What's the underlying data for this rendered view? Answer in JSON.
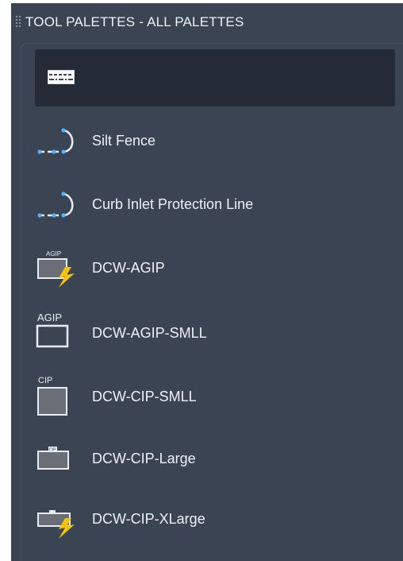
{
  "palette": {
    "title": "TOOL PALETTES - ALL PALETTES",
    "colors": {
      "background": "#3b4453",
      "selected_row": "#252b36",
      "text": "#eef1f5",
      "accent_blue": "#4fb3ff",
      "accent_yellow": "#f5c20f"
    }
  },
  "tools": [
    {
      "label": "Silt Fence",
      "icon": "silt-fence-line-icon"
    },
    {
      "label": "Curb Inlet Protection Line",
      "icon": "curb-inlet-protection-line-icon"
    },
    {
      "label": "DCW-AGIP",
      "icon": "agip-block-icon"
    },
    {
      "label": "DCW-AGIP-SMLL",
      "icon": "agip-small-block-icon"
    },
    {
      "label": "DCW-CIP-SMLL",
      "icon": "cip-small-block-icon"
    },
    {
      "label": "DCW-CIP-Large",
      "icon": "cip-large-block-icon"
    },
    {
      "label": "DCW-CIP-XLarge",
      "icon": "cip-xlarge-block-icon"
    }
  ],
  "icon_texts": {
    "agip": "AGIP",
    "cip": "CIP"
  }
}
